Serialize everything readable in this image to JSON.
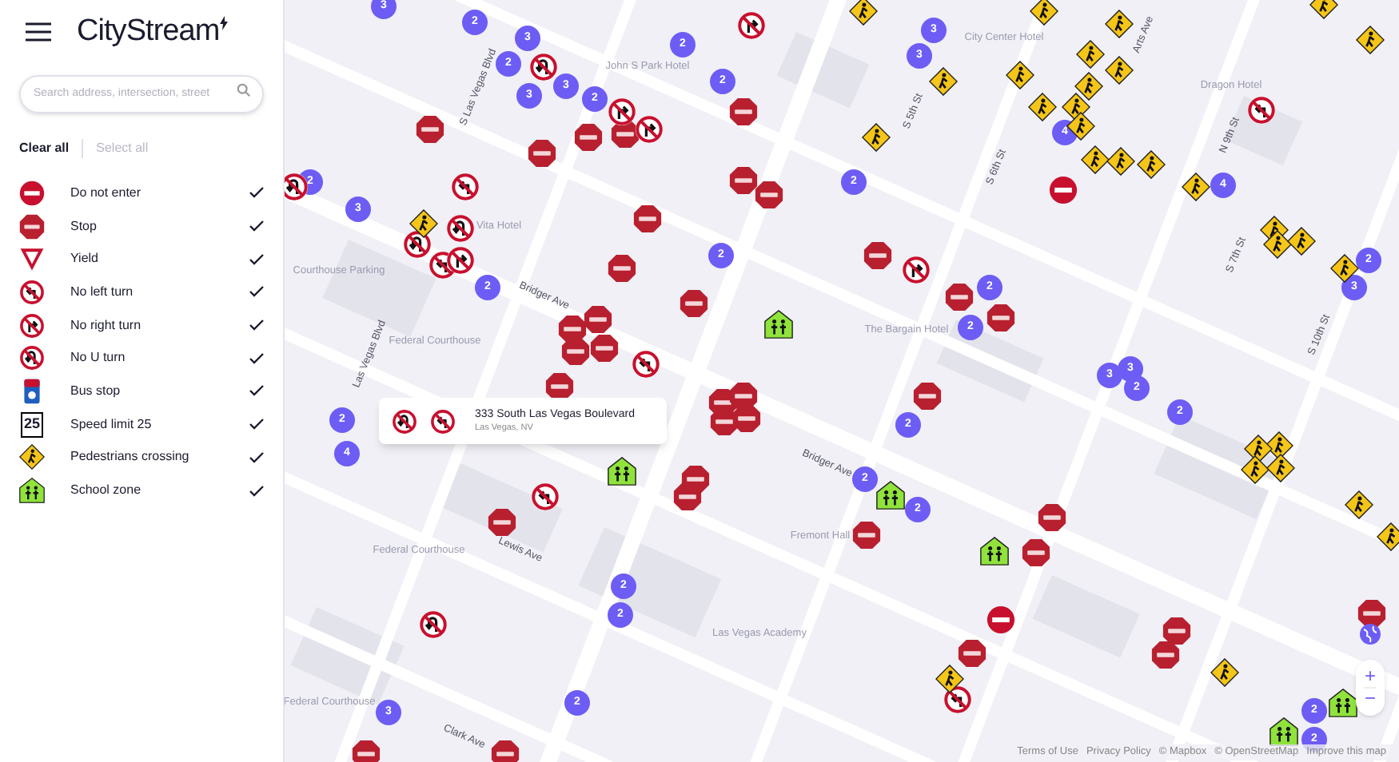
{
  "sidebar": {
    "logo": "CityStream",
    "search": {
      "placeholder": "Search address, intersection, street"
    },
    "actions": [
      {
        "label": "Clear all",
        "disabled": false
      },
      {
        "label": "Select all",
        "disabled": true
      }
    ],
    "legend": [
      {
        "kind": "no_entry",
        "label": "Do not enter",
        "checked": true
      },
      {
        "kind": "stop",
        "label": "Stop",
        "checked": true
      },
      {
        "kind": "yield",
        "label": "Yield",
        "checked": true
      },
      {
        "kind": "no_left",
        "label": "No left turn",
        "checked": true
      },
      {
        "kind": "no_right",
        "label": "No right turn",
        "checked": true
      },
      {
        "kind": "no_u",
        "label": "No U turn",
        "checked": true
      },
      {
        "kind": "bus",
        "label": "Bus stop",
        "checked": true
      },
      {
        "kind": "speed",
        "label": "Speed limit 25",
        "checked": true,
        "sign_text": "25"
      },
      {
        "kind": "pedestrian",
        "label": "Pedestrians crossing",
        "checked": true
      },
      {
        "kind": "school",
        "label": "School zone",
        "checked": true
      }
    ]
  },
  "map": {
    "labels": [
      {
        "kind": "street",
        "text": "S Las Vegas Blvd"
      },
      {
        "kind": "street",
        "text": "Las Vegas Blvd"
      },
      {
        "kind": "street",
        "text": "Bridger Ave"
      },
      {
        "kind": "street",
        "text": "Bridger Ave"
      },
      {
        "kind": "street",
        "text": "Lewis Ave"
      },
      {
        "kind": "street",
        "text": "Clark Ave"
      },
      {
        "kind": "street",
        "text": "S 5th St"
      },
      {
        "kind": "street",
        "text": "S 6th St"
      },
      {
        "kind": "street",
        "text": "N 9th St"
      },
      {
        "kind": "street",
        "text": "S 7th St"
      },
      {
        "kind": "street",
        "text": "S 10th St"
      },
      {
        "kind": "street",
        "text": "Arts Ave"
      },
      {
        "kind": "place",
        "text": "Federal Courthouse"
      },
      {
        "kind": "place",
        "text": "Federal Courthouse"
      },
      {
        "kind": "place",
        "text": "Federal Courthouse"
      },
      {
        "kind": "place",
        "text": "Las Vegas Academy"
      },
      {
        "kind": "place",
        "text": "Fremont Hall"
      },
      {
        "kind": "place",
        "text": "Vita Hotel"
      },
      {
        "kind": "place",
        "text": "John S Park Hotel"
      },
      {
        "kind": "place",
        "text": "The Bargain Hotel"
      },
      {
        "kind": "place",
        "text": "Courthouse Parking"
      },
      {
        "kind": "place",
        "text": "City Center Hotel"
      },
      {
        "kind": "place",
        "text": "Dragon Hotel"
      }
    ],
    "markers": [
      {
        "kind": "cluster",
        "count": "3"
      },
      {
        "kind": "cluster",
        "count": "2"
      },
      {
        "kind": "cluster",
        "count": "2"
      },
      {
        "kind": "cluster",
        "count": "3"
      },
      {
        "kind": "cluster",
        "count": "3"
      },
      {
        "kind": "cluster",
        "count": "3"
      },
      {
        "kind": "cluster",
        "count": "2"
      },
      {
        "kind": "cluster",
        "count": "2"
      },
      {
        "kind": "cluster",
        "count": "2"
      },
      {
        "kind": "cluster",
        "count": "3"
      },
      {
        "kind": "cluster",
        "count": "3"
      },
      {
        "kind": "cluster",
        "count": "2"
      },
      {
        "kind": "cluster",
        "count": "3"
      },
      {
        "kind": "cluster",
        "count": "2"
      },
      {
        "kind": "cluster",
        "count": "2"
      },
      {
        "kind": "cluster",
        "count": "2"
      },
      {
        "kind": "cluster",
        "count": "2"
      },
      {
        "kind": "cluster",
        "count": "2"
      },
      {
        "kind": "cluster",
        "count": "4"
      },
      {
        "kind": "cluster",
        "count": "4"
      },
      {
        "kind": "cluster",
        "count": "2"
      },
      {
        "kind": "cluster",
        "count": "3"
      },
      {
        "kind": "cluster",
        "count": "3"
      },
      {
        "kind": "cluster",
        "count": "3"
      },
      {
        "kind": "cluster",
        "count": "2"
      },
      {
        "kind": "cluster",
        "count": "2"
      },
      {
        "kind": "cluster",
        "count": "2"
      },
      {
        "kind": "cluster",
        "count": "4"
      },
      {
        "kind": "cluster",
        "count": "2"
      },
      {
        "kind": "cluster",
        "count": "2"
      },
      {
        "kind": "cluster",
        "count": "2"
      },
      {
        "kind": "cluster",
        "count": "2"
      },
      {
        "kind": "cluster",
        "count": "2"
      },
      {
        "kind": "cluster",
        "count": "2"
      },
      {
        "kind": "cluster",
        "count": "3"
      },
      {
        "kind": "cluster",
        "count": "2"
      },
      {
        "kind": "cluster",
        "count": "2"
      },
      {
        "kind": "stop"
      },
      {
        "kind": "stop"
      },
      {
        "kind": "stop"
      },
      {
        "kind": "stop"
      },
      {
        "kind": "stop"
      },
      {
        "kind": "stop"
      },
      {
        "kind": "stop"
      },
      {
        "kind": "stop"
      },
      {
        "kind": "stop"
      },
      {
        "kind": "stop"
      },
      {
        "kind": "stop"
      },
      {
        "kind": "stop"
      },
      {
        "kind": "stop"
      },
      {
        "kind": "stop"
      },
      {
        "kind": "stop"
      },
      {
        "kind": "stop"
      },
      {
        "kind": "stop"
      },
      {
        "kind": "stop"
      },
      {
        "kind": "stop"
      },
      {
        "kind": "stop"
      },
      {
        "kind": "stop"
      },
      {
        "kind": "stop"
      },
      {
        "kind": "stop"
      },
      {
        "kind": "stop"
      },
      {
        "kind": "stop"
      },
      {
        "kind": "stop"
      },
      {
        "kind": "stop"
      },
      {
        "kind": "stop"
      },
      {
        "kind": "stop"
      },
      {
        "kind": "stop"
      },
      {
        "kind": "stop"
      },
      {
        "kind": "stop"
      },
      {
        "kind": "stop"
      },
      {
        "kind": "stop"
      },
      {
        "kind": "stop"
      },
      {
        "kind": "no_entry"
      },
      {
        "kind": "no_entry"
      },
      {
        "kind": "no_right"
      },
      {
        "kind": "no_u"
      },
      {
        "kind": "no_right"
      },
      {
        "kind": "no_u"
      },
      {
        "kind": "no_left"
      },
      {
        "kind": "no_u"
      },
      {
        "kind": "no_u"
      },
      {
        "kind": "no_left"
      },
      {
        "kind": "no_right"
      },
      {
        "kind": "no_right"
      },
      {
        "kind": "no_left"
      },
      {
        "kind": "no_left"
      },
      {
        "kind": "no_left"
      },
      {
        "kind": "no_u"
      },
      {
        "kind": "no_right"
      },
      {
        "kind": "no_left"
      },
      {
        "kind": "pedestrian"
      },
      {
        "kind": "pedestrian"
      },
      {
        "kind": "pedestrian"
      },
      {
        "kind": "pedestrian"
      },
      {
        "kind": "pedestrian"
      },
      {
        "kind": "pedestrian"
      },
      {
        "kind": "pedestrian"
      },
      {
        "kind": "pedestrian"
      },
      {
        "kind": "pedestrian"
      },
      {
        "kind": "pedestrian"
      },
      {
        "kind": "pedestrian"
      },
      {
        "kind": "pedestrian"
      },
      {
        "kind": "pedestrian"
      },
      {
        "kind": "pedestrian"
      },
      {
        "kind": "pedestrian"
      },
      {
        "kind": "pedestrian"
      },
      {
        "kind": "pedestrian"
      },
      {
        "kind": "pedestrian"
      },
      {
        "kind": "pedestrian"
      },
      {
        "kind": "pedestrian"
      },
      {
        "kind": "pedestrian"
      },
      {
        "kind": "pedestrian"
      },
      {
        "kind": "pedestrian"
      },
      {
        "kind": "pedestrian"
      },
      {
        "kind": "pedestrian"
      },
      {
        "kind": "pedestrian"
      },
      {
        "kind": "pedestrian"
      },
      {
        "kind": "pedestrian"
      },
      {
        "kind": "pedestrian"
      },
      {
        "kind": "pedestrian"
      },
      {
        "kind": "pedestrian"
      },
      {
        "kind": "school"
      },
      {
        "kind": "school"
      },
      {
        "kind": "school"
      },
      {
        "kind": "school"
      },
      {
        "kind": "school"
      },
      {
        "kind": "school"
      }
    ],
    "popup": {
      "signs": [
        {
          "kind": "no_u"
        },
        {
          "kind": "no_left"
        }
      ],
      "title": "333 South Las Vegas Boulevard",
      "subtitle": "Las Vegas, NV"
    },
    "zoom": {
      "zoom_in": "+",
      "zoom_out": "−"
    },
    "attribution": [
      "Terms of Use",
      "Privacy Policy",
      "© Mapbox",
      "© OpenStreetMap",
      "Improve this map"
    ]
  }
}
